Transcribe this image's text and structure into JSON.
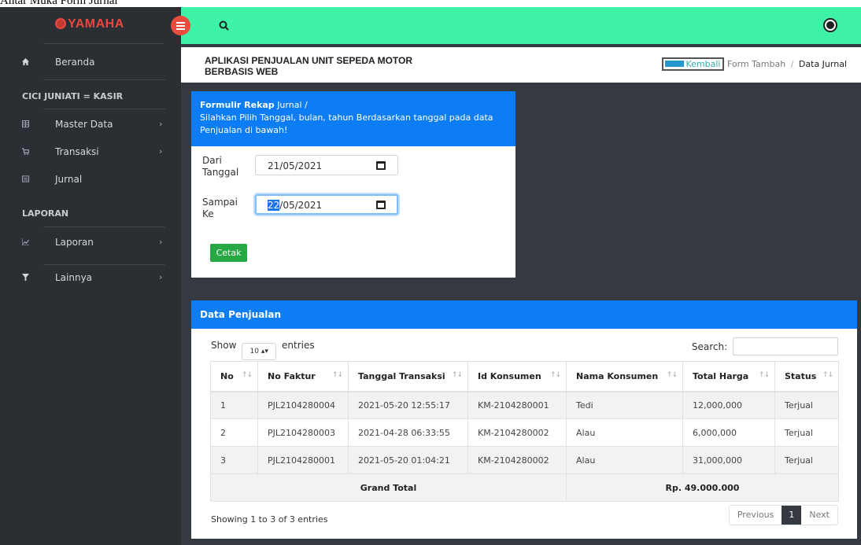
{
  "caption": "Antar Muka Form Jurnal",
  "brand": {
    "logo_text": "YAMAHA"
  },
  "sidebar": {
    "home": "Beranda",
    "user_role": "CICI JUNIATI = KASIR",
    "items": [
      {
        "label": "Master Data",
        "icon": "table-icon"
      },
      {
        "label": "Transaksi",
        "icon": "cart-icon"
      },
      {
        "label": "Jurnal",
        "icon": "journal-icon"
      }
    ],
    "report_heading": "LAPORAN",
    "report_items": [
      {
        "label": "Laporan",
        "icon": "chart-line-icon"
      },
      {
        "label": "Lainnya",
        "icon": "filter-icon"
      }
    ]
  },
  "header": {
    "app_title": "APLIKASI PENJUALAN UNIT SEPEDA MOTOR BERBASIS WEB",
    "back_label": "Kembali",
    "breadcrumb_1": "Form Tambah",
    "breadcrumb_sep": "/",
    "breadcrumb_current": "Data Jurnal"
  },
  "form": {
    "title_bold": "Formulir Rekap",
    "title_rest": "Jurnal /",
    "instruction": "Silahkan Pilih Tanggal, bulan, tahun Berdasarkan tanggal pada data Penjualan di bawah!",
    "from_label": "Dari Tanggal",
    "from_value": "21/05/2021",
    "to_label": "Sampai Ke",
    "to_day_selected": "22",
    "to_value_rest": "/05/2021",
    "submit_label": "Cetak"
  },
  "table_card": {
    "title": "Data Penjualan",
    "show_label": "Show",
    "page_length": "10",
    "entries_label": "entries",
    "search_label": "Search:",
    "columns": [
      "No",
      "No Faktur",
      "Tanggal Transaksi",
      "Id Konsumen",
      "Nama Konsumen",
      "Total Harga",
      "Status"
    ],
    "rows": [
      [
        "1",
        "PJL2104280004",
        "2021-05-20 12:55:17",
        "KM-2104280001",
        "Tedi",
        "12,000,000",
        "Terjual"
      ],
      [
        "2",
        "PJL2104280003",
        "2021-04-28 06:33:55",
        "KM-2104280002",
        "Alau",
        "6,000,000",
        "Terjual"
      ],
      [
        "3",
        "PJL2104280001",
        "2021-05-20 01:04:21",
        "KM-2104280002",
        "Alau",
        "31,000,000",
        "Terjual"
      ]
    ],
    "grand_total_label": "Grand Total",
    "grand_total_value": "Rp. 49.000.000",
    "info": "Showing 1 to 3 of 3 entries",
    "prev_label": "Previous",
    "current_page": "1",
    "next_label": "Next"
  },
  "colors": {
    "topbar": "#3ef2a8",
    "sidebar": "#2b2f33",
    "card_header": "#0d7df5",
    "cetak": "#28a745",
    "toggle": "#e84c3d"
  }
}
